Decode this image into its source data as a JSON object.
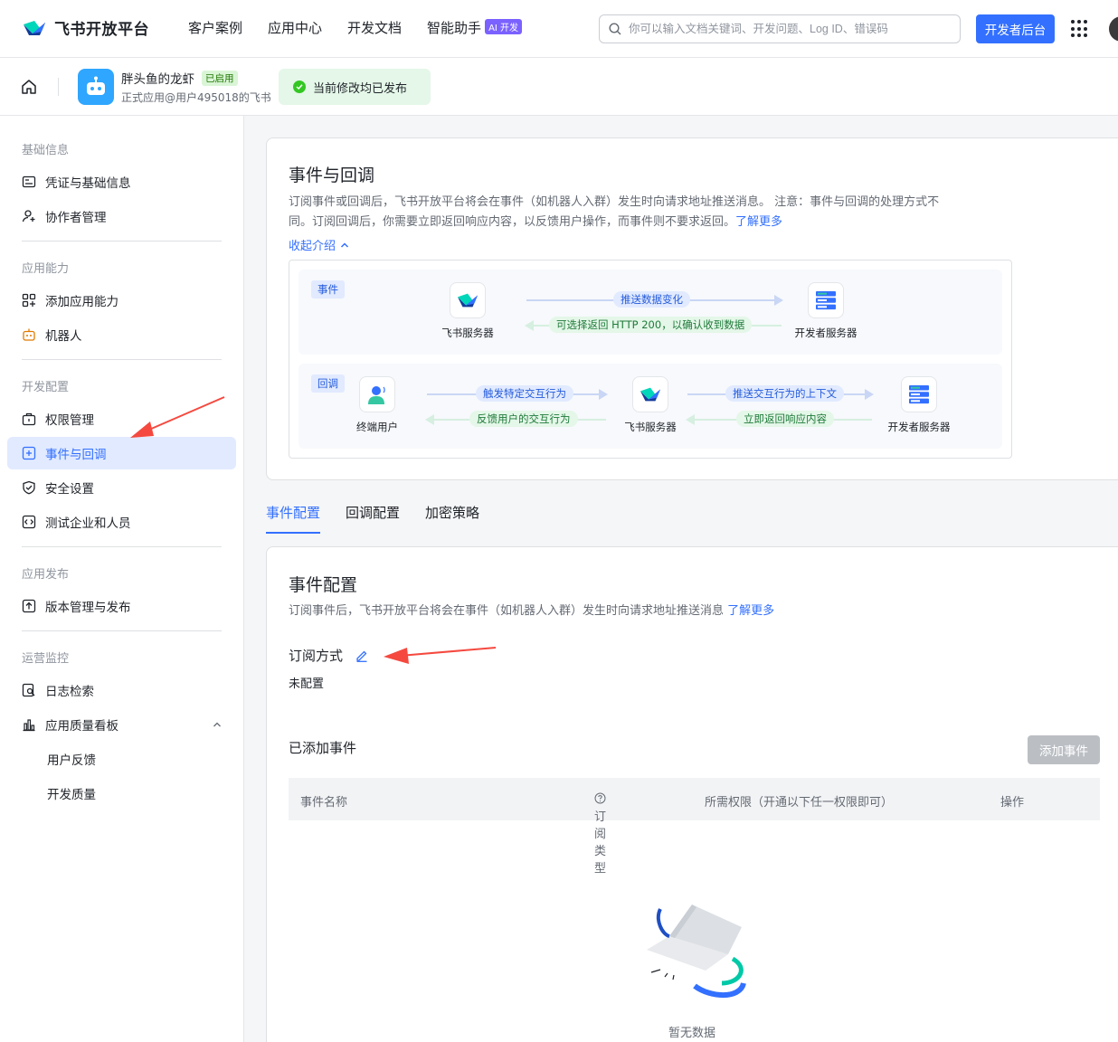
{
  "topnav": {
    "brand": "飞书开放平台",
    "links": [
      "客户案例",
      "应用中心",
      "开发文档",
      "智能助手"
    ],
    "ai_badge": "AI 开发",
    "search_placeholder": "你可以输入文档关键词、开发问题、Log ID、错误码",
    "dev_console": "开发者后台"
  },
  "app": {
    "name": "胖头鱼的龙虾",
    "status_badge": "已启用",
    "subtitle": "正式应用@用户495018的飞书",
    "publish_status": "当前修改均已发布"
  },
  "sidebar": {
    "groups": {
      "basic": "基础信息",
      "capability": "应用能力",
      "dev_config": "开发配置",
      "release": "应用发布",
      "monitor": "运营监控"
    },
    "items": {
      "credentials": "凭证与基础信息",
      "collaborators": "协作者管理",
      "add_capability": "添加应用能力",
      "bot": "机器人",
      "permissions": "权限管理",
      "events": "事件与回调",
      "security": "安全设置",
      "test_org": "测试企业和人员",
      "versions": "版本管理与发布",
      "log_search": "日志检索",
      "quality_board": "应用质量看板",
      "feedback": "用户反馈",
      "dev_quality": "开发质量"
    }
  },
  "intro": {
    "title": "事件与回调",
    "desc_line1": "订阅事件或回调后，飞书开放平台将会在事件（如机器人入群）发生时向请求地址推送消息。 注意：事件与回调的处理方式不",
    "desc_line2": "同。订阅回调后，你需要立即返回响应内容，以反馈用户操作，而事件则不要求返回。",
    "learn_more": "了解更多",
    "collapse": "收起介绍"
  },
  "diagram": {
    "event_tag": "事件",
    "callback_tag": "回调",
    "feishu_server": "飞书服务器",
    "dev_server": "开发者服务器",
    "end_user": "终端用户",
    "push_change": "推送数据变化",
    "optional_return": "可选择返回 HTTP 200，以确认收到数据",
    "trigger": "触发特定交互行为",
    "feedback": "反馈用户的交互行为",
    "push_context": "推送交互行为的上下文",
    "respond": "立即返回响应内容"
  },
  "tabs": [
    "事件配置",
    "回调配置",
    "加密策略"
  ],
  "event_config": {
    "title": "事件配置",
    "desc": "订阅事件后，飞书开放平台将会在事件（如机器人入群）发生时向请求地址推送消息",
    "learn_more": "了解更多",
    "subscribe_label": "订阅方式",
    "subscribe_value": "未配置",
    "added_events": "已添加事件",
    "add_button": "添加事件",
    "columns": [
      "事件名称",
      "订阅类型",
      "所需权限（开通以下任一权限即可）",
      "操作"
    ],
    "empty": "暂无数据"
  }
}
